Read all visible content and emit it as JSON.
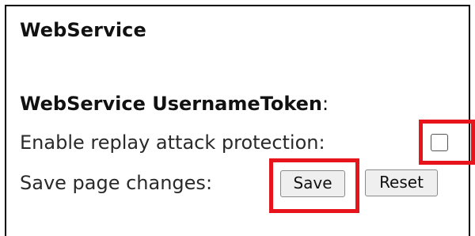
{
  "page": {
    "title": "WebService"
  },
  "section": {
    "title": "WebService UsernameToken",
    "title_suffix": ":"
  },
  "replay": {
    "label": "Enable replay attack protection:",
    "checked": false
  },
  "save_row": {
    "label": "Save page changes:",
    "save_label": "Save",
    "reset_label": "Reset"
  },
  "colors": {
    "highlight": "#e8141c",
    "button_bg": "#efefef"
  }
}
